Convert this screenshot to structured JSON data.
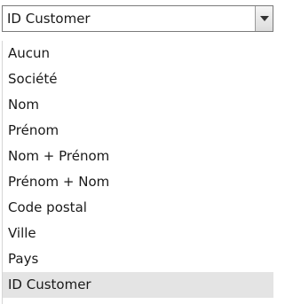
{
  "combo": {
    "selected_value": "ID Customer",
    "button_icon": "chevron-down-icon"
  },
  "options": [
    {
      "label": "Aucun"
    },
    {
      "label": "Société"
    },
    {
      "label": "Nom"
    },
    {
      "label": "Prénom"
    },
    {
      "label": "Nom + Prénom"
    },
    {
      "label": "Prénom + Nom"
    },
    {
      "label": "Code postal"
    },
    {
      "label": "Ville"
    },
    {
      "label": "Pays"
    },
    {
      "label": "ID Customer",
      "selected": true
    }
  ],
  "colors": {
    "selected_background": "#e4e4e4",
    "combo_border": "#7a7a7a"
  }
}
